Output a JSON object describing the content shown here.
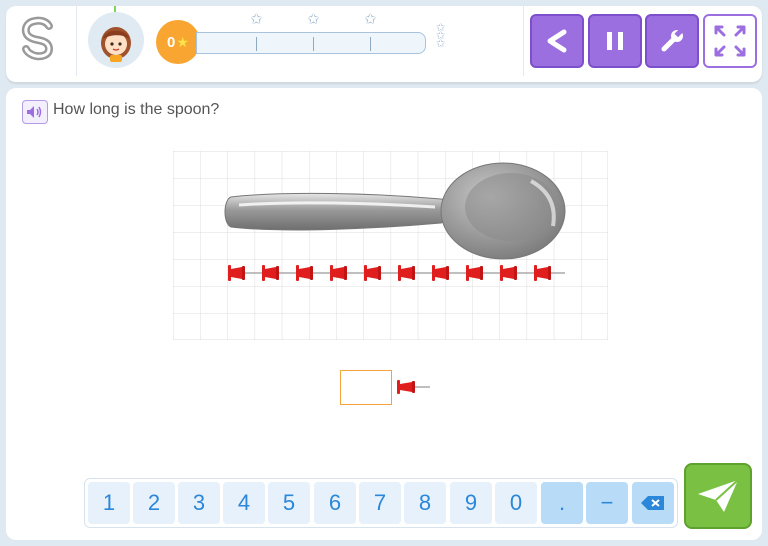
{
  "header": {
    "score_value": "0",
    "progress_stars": 3,
    "buttons": {
      "back_icon": "back-arrow-icon",
      "pause_icon": "pause-icon",
      "settings_icon": "wrench-icon",
      "fullscreen_icon": "fullscreen-icon"
    }
  },
  "question": {
    "text": "How long is the spoon?",
    "speaker_icon": "speaker-icon"
  },
  "figure": {
    "object": "spoon",
    "pin_count": 10,
    "unit_icon": "pushpin-icon"
  },
  "answer": {
    "value": ""
  },
  "keypad": {
    "keys": [
      "1",
      "2",
      "3",
      "4",
      "5",
      "6",
      "7",
      "8",
      "9",
      "0",
      ".",
      "−"
    ],
    "backspace_icon": "backspace-icon"
  },
  "submit": {
    "icon": "paper-plane-icon"
  },
  "colors": {
    "accent_purple": "#9c6fe0",
    "submit_green": "#7ac143",
    "pin_red": "#e01e1e",
    "score_orange": "#f9a531"
  }
}
